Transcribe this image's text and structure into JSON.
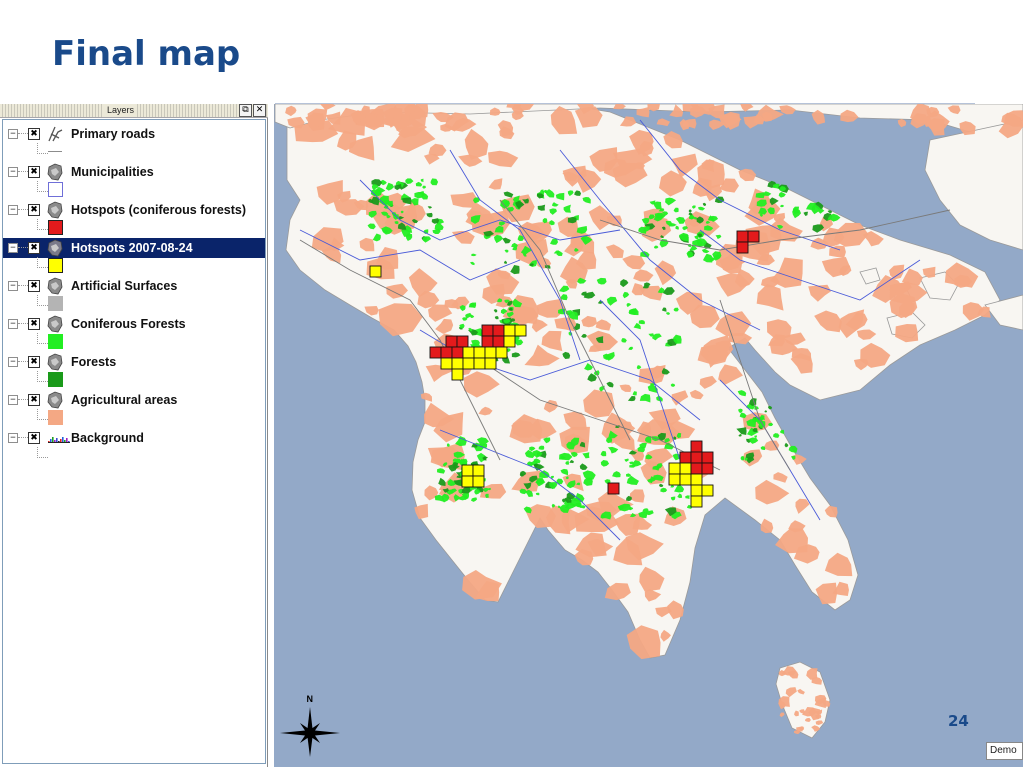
{
  "slide": {
    "title": "Final map",
    "page_number": "24"
  },
  "layers_panel": {
    "title": "Layers",
    "float_button": "⧉",
    "close_button": "✕",
    "layers": [
      {
        "name": "Primary roads",
        "checked": "✖",
        "expander": "−",
        "icon": "roads-icon",
        "legend": "line",
        "color": "#8c8c8c",
        "selected": false
      },
      {
        "name": "Municipalities",
        "checked": "✖",
        "expander": "−",
        "icon": "polygon-layer-icon",
        "legend": "swatch",
        "color": "#ffffff",
        "border": "#6f6fd8",
        "selected": false
      },
      {
        "name": "Hotspots (coniferous forests)",
        "checked": "✖",
        "expander": "−",
        "icon": "polygon-layer-icon",
        "legend": "swatch",
        "color": "#e31a1c",
        "border": "#222222",
        "selected": false
      },
      {
        "name": "Hotspots 2007-08-24",
        "checked": "✖",
        "expander": "−",
        "icon": "polygon-layer-icon",
        "legend": "swatch",
        "color": "#ffff00",
        "border": "#222222",
        "selected": true
      },
      {
        "name": "Artificial Surfaces",
        "checked": "✖",
        "expander": "−",
        "icon": "polygon-layer-icon",
        "legend": "swatch",
        "color": "#b4b4b4",
        "border": "#b4b4b4",
        "selected": false
      },
      {
        "name": "Coniferous Forests",
        "checked": "✖",
        "expander": "−",
        "icon": "polygon-layer-icon",
        "legend": "swatch",
        "color": "#22ee22",
        "border": "#22ee22",
        "selected": false
      },
      {
        "name": "Forests",
        "checked": "✖",
        "expander": "−",
        "icon": "polygon-layer-icon",
        "legend": "swatch",
        "color": "#1a9a1a",
        "border": "#1a9a1a",
        "selected": false
      },
      {
        "name": "Agricultural areas",
        "checked": "✖",
        "expander": "−",
        "icon": "polygon-layer-icon",
        "legend": "swatch",
        "color": "#f4a884",
        "border": "#f4a884",
        "selected": false
      },
      {
        "name": "Background",
        "checked": "✖",
        "expander": "−",
        "icon": "raster-layer-icon",
        "legend": "raster",
        "color": "#3a4bd6",
        "selected": false
      }
    ]
  },
  "map": {
    "sea_color": "#93a9c8",
    "land_color": "#f8f6f2",
    "agri_color": "#f4a884",
    "forest_color": "#22ee22",
    "forest_dark_color": "#1a9a1a",
    "hotspot_red": "#e31a1c",
    "hotspot_yellow": "#ffff00",
    "north_label": "N",
    "demo_label": "Demo"
  }
}
